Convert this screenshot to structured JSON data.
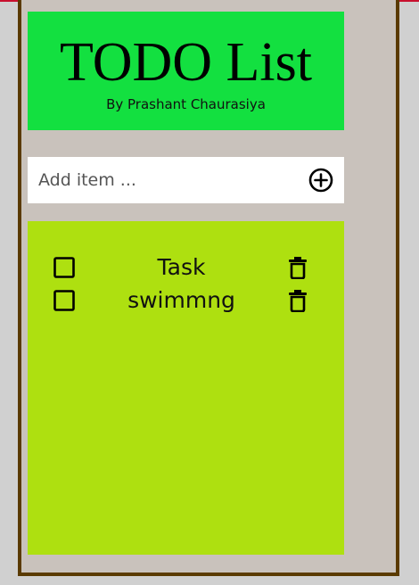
{
  "header": {
    "title": "TODO List",
    "subtitle": "By Prashant Chaurasiya"
  },
  "add_item": {
    "placeholder": "Add item ...",
    "value": "",
    "button_icon": "plus-circle-icon"
  },
  "tasks": [
    {
      "text": "Task",
      "checked": false,
      "check_icon": "checkbox-icon",
      "delete_icon": "trash-icon"
    },
    {
      "text": "swimmng",
      "checked": false,
      "check_icon": "checkbox-icon",
      "delete_icon": "trash-icon"
    }
  ],
  "colors": {
    "header_bg": "#13e040",
    "list_bg": "#aee010",
    "frame_bg": "#c9c2bc",
    "frame_border": "#5a3a00",
    "page_bg": "#d0d0d0",
    "accent_line": "#c8102e"
  }
}
